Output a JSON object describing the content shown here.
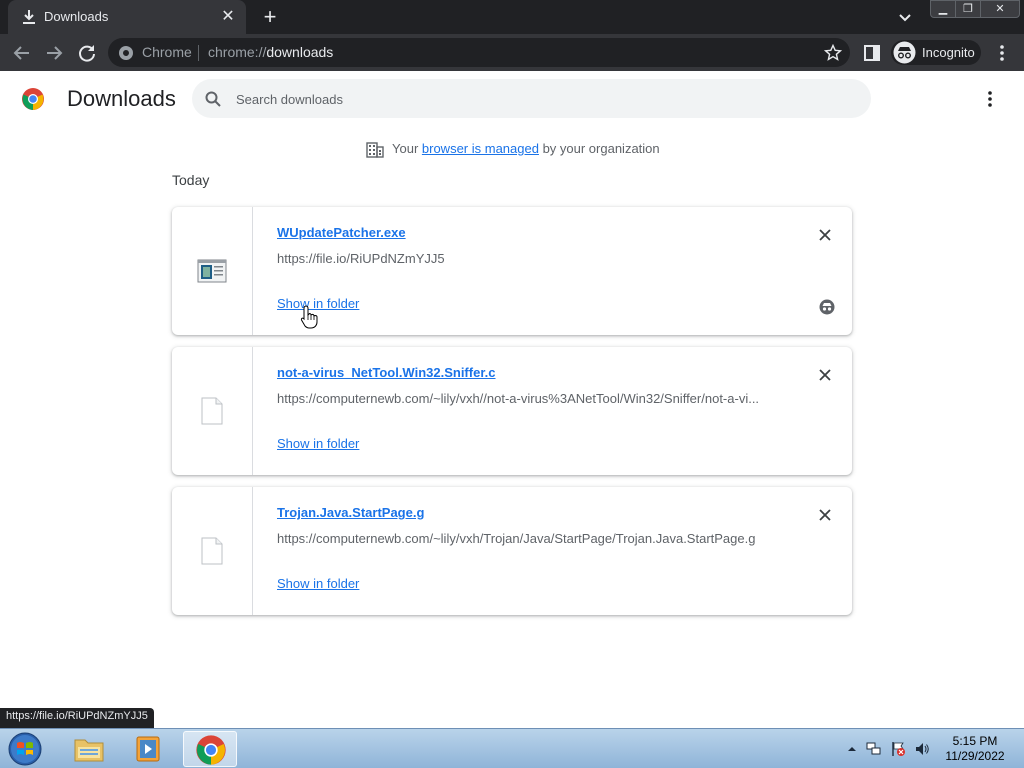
{
  "tab": {
    "title": "Downloads",
    "icon": "download-icon"
  },
  "window_controls": {
    "minimize": "minimize-icon",
    "maximize": "restore-icon",
    "close": "close-icon"
  },
  "toolbar": {
    "site_name": "Chrome",
    "url_scheme": "chrome://",
    "url_host": "downloads",
    "incognito_label": "Incognito"
  },
  "page": {
    "title": "Downloads",
    "search_placeholder": "Search downloads",
    "managed_prefix": "Your ",
    "managed_link": "browser is managed",
    "managed_suffix": " by your organization",
    "section": "Today"
  },
  "downloads": [
    {
      "name": "WUpdatePatcher.exe",
      "url": "https://file.io/RiUPdNZmYJJ5",
      "action": "Show in folder",
      "icon": "exe-file-icon",
      "incognito": true
    },
    {
      "name": "not-a-virus_NetTool.Win32.Sniffer.c",
      "url": "https://computernewb.com/~lily/vxh//not-a-virus%3ANetTool/Win32/Sniffer/not-a-vi...",
      "action": "Show in folder",
      "icon": "generic-file-icon",
      "incognito": false
    },
    {
      "name": "Trojan.Java.StartPage.g",
      "url": "https://computernewb.com/~lily/vxh/Trojan/Java/StartPage/Trojan.Java.StartPage.g",
      "action": "Show in folder",
      "icon": "generic-file-icon",
      "incognito": false
    }
  ],
  "status_bubble": "https://file.io/RiUPdNZmYJJ5",
  "taskbar": {
    "time": "5:15 PM",
    "date": "11/29/2022"
  },
  "colors": {
    "accent": "#1a73e8",
    "chrome_dark": "#35363a",
    "tab_strip": "#202124"
  }
}
